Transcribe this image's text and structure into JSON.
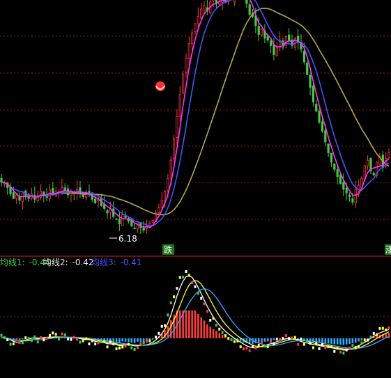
{
  "chart_data": [
    {
      "type": "candlestick",
      "panel": "price",
      "annotations": {
        "low_marker": "6.18",
        "signal_left": "跌",
        "signal_right": "涨"
      },
      "colors": {
        "up": "#ff3b3b",
        "down": "#3ecf3e",
        "ma_short": "#ff33ff",
        "ma_mid": "#4455ff",
        "ma_long": "#b8a64a",
        "grid": "#8a1a1a"
      },
      "closes": [
        9.0,
        8.95,
        8.7,
        8.35,
        8.1,
        8.3,
        8.0,
        8.4,
        8.2,
        8.1,
        8.35,
        8.05,
        8.25,
        8.5,
        8.3,
        8.15,
        8.6,
        8.3,
        8.5,
        8.4,
        8.7,
        8.55,
        8.3,
        8.5,
        8.35,
        8.6,
        8.4,
        8.2,
        8.45,
        8.3,
        8.05,
        7.85,
        8.1,
        7.7,
        7.55,
        7.3,
        7.6,
        7.1,
        6.95,
        6.7,
        7.2,
        7.05,
        6.85,
        6.6,
        6.45,
        6.8,
        6.5,
        6.35,
        6.55,
        6.7,
        6.9,
        7.3,
        7.6,
        8.0,
        8.5,
        9.2,
        10.2,
        11.4,
        12.6,
        13.8,
        14.9,
        15.8,
        16.6,
        17.2,
        17.7,
        18.1,
        18.5,
        18.7,
        18.4,
        18.9,
        19.1,
        18.8,
        18.9,
        19.2,
        18.9,
        19.4,
        19.0,
        19.6,
        19.9,
        19.5,
        19.7,
        18.8,
        18.2,
        18.1,
        17.6,
        17.1,
        17.4,
        16.9,
        16.8,
        16.5,
        16.0,
        16.4,
        16.8,
        16.5,
        17.0,
        16.8,
        16.5,
        16.9,
        16.7,
        16.3,
        15.6,
        14.9,
        14.2,
        13.4,
        12.9,
        12.3,
        11.8,
        11.2,
        10.6,
        10.1,
        9.7,
        9.3,
        8.9,
        8.6,
        8.4,
        8.2,
        7.9,
        8.6,
        8.8,
        9.2,
        9.9,
        10.2,
        9.6,
        9.4,
        10.1,
        10.4,
        9.8,
        10.3,
        10.6
      ],
      "series": [
        {
          "name": "",
          "values": []
        }
      ]
    },
    {
      "type": "histogram+line",
      "panel": "indicator",
      "legend": [
        {
          "label": "均线1:",
          "value": "-0.44",
          "color": "#3ecf3e"
        },
        {
          "label": "均线2:",
          "value": "-0.42",
          "color": "#e8e8e8"
        },
        {
          "label": "均线3:",
          "value": "-0.41",
          "color": "#4455ff"
        }
      ],
      "colors": {
        "line_white": "#ffffff",
        "line_yellow": "#ffff33",
        "line_blue": "#33aaff",
        "bar_pos": "#ff3b3b",
        "bar_neg": "#33aaff",
        "dots": [
          "#ffff33",
          "#3ecf3e",
          "#ff3b3b",
          "#ffffff"
        ]
      },
      "values": [
        0.1,
        0.0,
        -0.1,
        -0.3,
        -0.45,
        -0.3,
        -0.2,
        -0.15,
        -0.1,
        0.05,
        0.1,
        0.0,
        -0.05,
        0.1,
        0.15,
        0.05,
        0.1,
        0.2,
        0.1,
        0.05,
        0.15,
        0.1,
        0.0,
        0.1,
        0.05,
        0.0,
        -0.1,
        -0.15,
        -0.05,
        -0.2,
        -0.3,
        -0.35,
        -0.25,
        -0.4,
        -0.5,
        -0.55,
        -0.45,
        -0.6,
        -0.65,
        -0.75,
        -0.5,
        -0.55,
        -0.6,
        -0.7,
        -0.75,
        -0.55,
        -0.6,
        -0.65,
        -0.5,
        -0.35,
        -0.2,
        0.1,
        0.4,
        0.8,
        1.3,
        2.0,
        3.0,
        3.8,
        4.6,
        5.2,
        5.6,
        5.8,
        5.5,
        5.1,
        4.6,
        4.0,
        3.4,
        2.9,
        2.3,
        1.9,
        1.5,
        1.2,
        0.9,
        0.6,
        0.4,
        0.2,
        0.0,
        -0.2,
        -0.35,
        -0.5,
        -0.7,
        -0.8,
        -0.85,
        -0.9,
        -0.8,
        -0.7,
        -0.6,
        -0.55,
        -0.5,
        -0.4,
        -0.3,
        -0.2,
        -0.1,
        -0.05,
        0.0,
        0.05,
        -0.1,
        -0.2,
        -0.3,
        -0.35,
        -0.4,
        -0.5,
        -0.55,
        -0.6,
        -0.65,
        -0.7,
        -0.75,
        -0.8,
        -0.85,
        -0.9,
        -0.95,
        -1.0,
        -1.05,
        -1.1,
        -1.0,
        -0.9,
        -0.8,
        -0.7,
        -0.5,
        -0.35,
        -0.2,
        0.0,
        0.2,
        0.35,
        0.5,
        0.6,
        0.7,
        0.8,
        0.9
      ]
    }
  ]
}
